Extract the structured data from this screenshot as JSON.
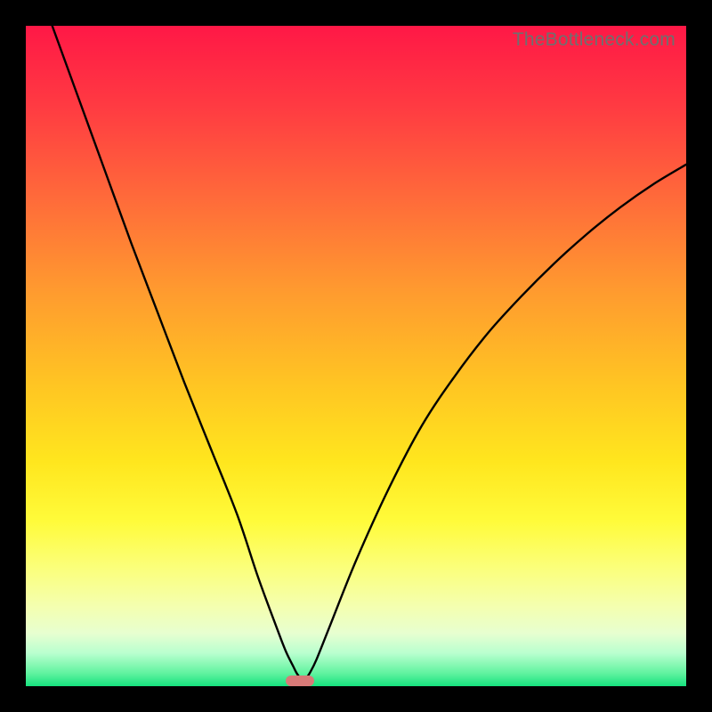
{
  "watermark": "TheBottleneck.com",
  "chart_data": {
    "type": "line",
    "title": "",
    "xlabel": "",
    "ylabel": "",
    "xlim": [
      0,
      100
    ],
    "ylim": [
      0,
      100
    ],
    "grid": false,
    "series": [
      {
        "name": "curve",
        "x": [
          4,
          8,
          12,
          16,
          20,
          24,
          28,
          32,
          35,
          37,
          38.5,
          39.5,
          40.5,
          41,
          41.5,
          42,
          42.5,
          43,
          44,
          46,
          50,
          55,
          60,
          65,
          70,
          75,
          80,
          85,
          90,
          95,
          100
        ],
        "y": [
          100,
          89,
          78,
          67,
          56.5,
          46,
          36,
          26,
          17,
          11.5,
          7.5,
          5,
          3,
          2,
          1.3,
          0.8,
          1.3,
          2,
          4,
          9,
          19,
          30,
          39.5,
          47,
          53.5,
          59,
          64,
          68.5,
          72.5,
          76,
          79
        ]
      }
    ],
    "marker": {
      "x_center": 41.5,
      "y_center": 0.8,
      "width_pct": 4.2,
      "height_pct": 1.6,
      "color": "#d87a78"
    },
    "background_gradient": {
      "top_color": "#ff1846",
      "bottom_color": "#16e27e"
    }
  }
}
